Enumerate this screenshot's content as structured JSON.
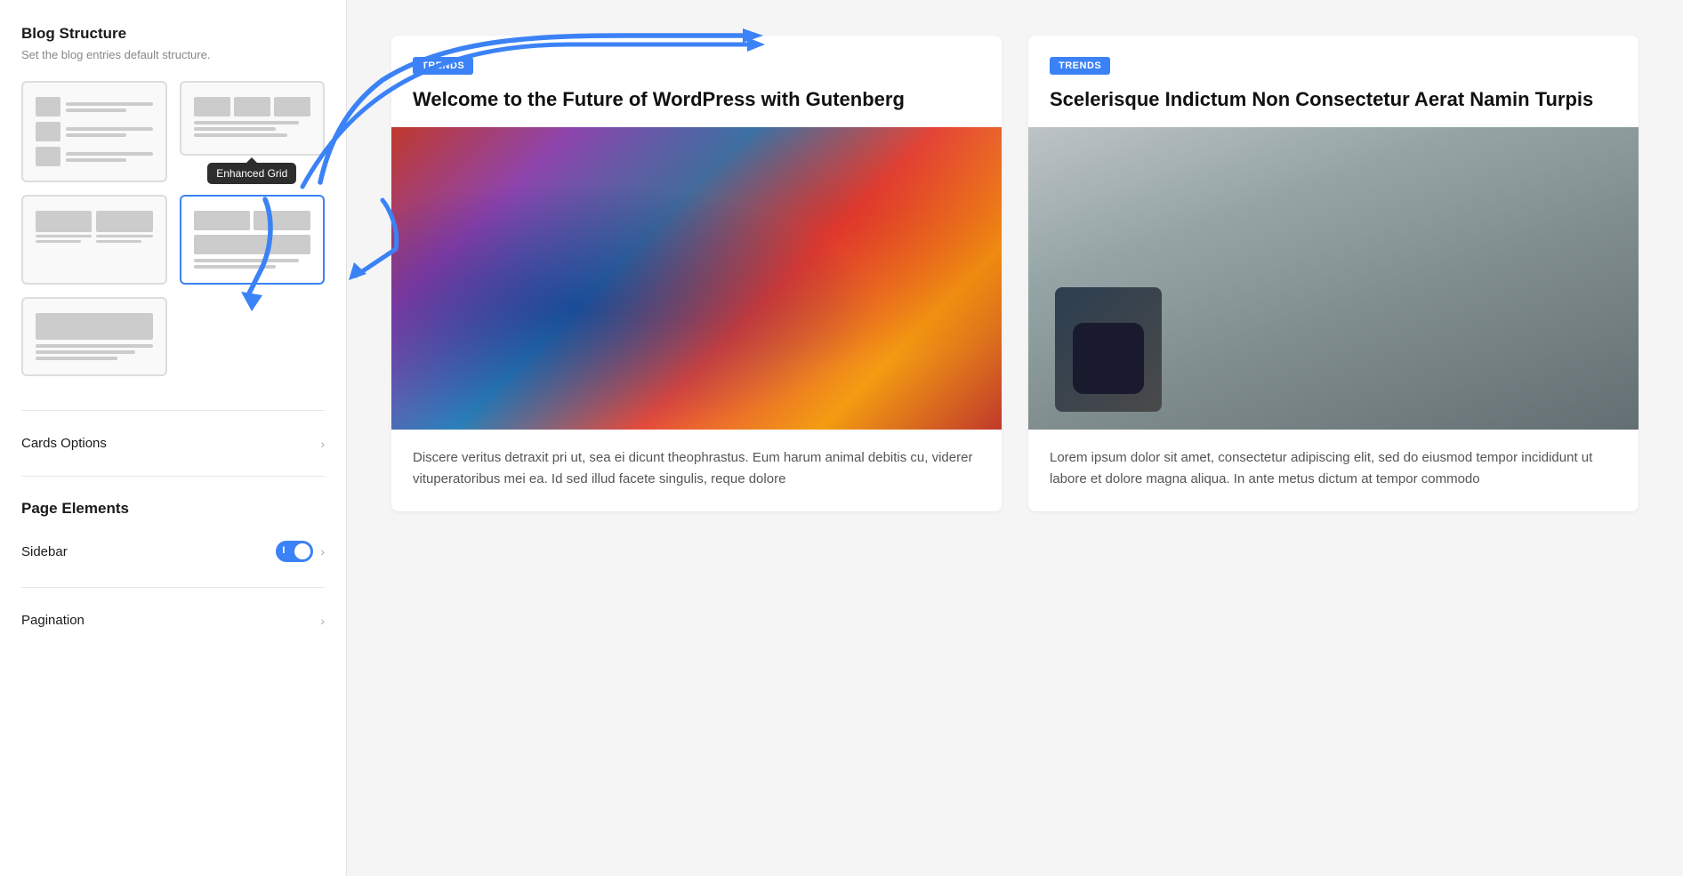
{
  "sidebar": {
    "title": "Blog Structure",
    "subtitle": "Set the blog entries default structure.",
    "cards_options_label": "Cards Options",
    "page_elements_title": "Page Elements",
    "sidebar_label": "Sidebar",
    "sidebar_toggle_text": "I",
    "sidebar_toggle_on": true,
    "pagination_label": "Pagination",
    "tooltip_text": "Enhanced Grid",
    "chevron": "›"
  },
  "main": {
    "card1": {
      "badge": "TRENDS",
      "title": "Welcome to the Future of WordPress with Gutenberg",
      "excerpt": "Discere veritus detraxit pri ut, sea ei dicunt theophrastus. Eum harum animal debitis cu, viderer vituperatoribus mei ea. Id sed illud facete singulis, reque dolore"
    },
    "card2": {
      "badge": "TRENDS",
      "title": "Scelerisque Indictum Non Consectetur Aerat Namin Turpis",
      "excerpt": "Lorem ipsum dolor sit amet, consectetur adipiscing elit, sed do eiusmod tempor incididunt ut labore et dolore magna aliqua. In ante metus dictum at tempor commodo"
    }
  }
}
